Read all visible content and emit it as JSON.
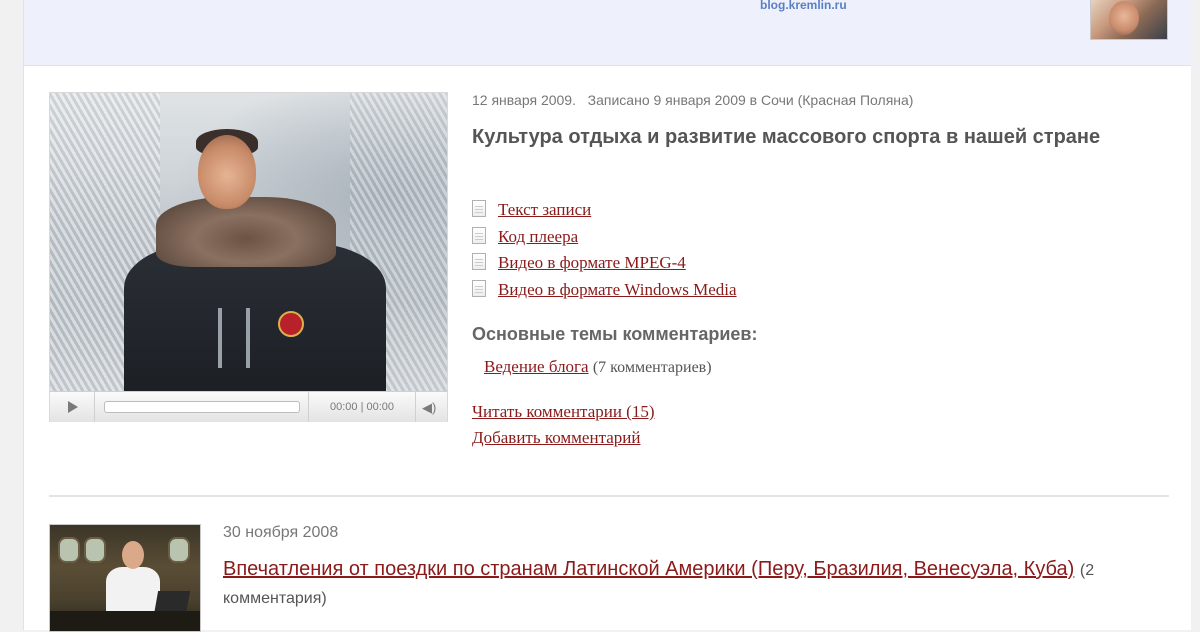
{
  "header": {
    "site_label": "blog.kremlin.ru",
    "avatar_icon": "author-avatar"
  },
  "post1": {
    "date": "12 января 2009.",
    "recorded": "Записано 9 января 2009 в Сочи (Красная Поляна)",
    "title": "Культура отдыха и развитие массового спорта в нашей стране",
    "player": {
      "time": "00:00 | 00:00",
      "progress": 0,
      "play_icon": "play-icon",
      "volume_icon": "volume-icon"
    },
    "files": [
      {
        "label": "Текст записи",
        "icon": "document-icon"
      },
      {
        "label": "Код плеера",
        "icon": "document-icon"
      },
      {
        "label": "Видео в формате MPEG-4",
        "icon": "document-icon"
      },
      {
        "label": "Видео в формате Windows Media",
        "icon": "document-icon"
      }
    ],
    "themes_heading": "Основные темы комментариев:",
    "theme": {
      "label": "Ведение блога",
      "count": "(7 комментариев)"
    },
    "read_comments": "Читать комментарии (15)",
    "add_comment": "Добавить комментарий"
  },
  "post2": {
    "date": "30 ноября 2008",
    "title": "Впечатления от поездки по странам Латинской Америки (Перу, Бразилия, Венесуэла, Куба)",
    "comments": "(2 комментария)"
  },
  "colors": {
    "link": "#8b1a1a",
    "header_bg": "#eef1fc",
    "header_link": "#5a7fc4"
  }
}
